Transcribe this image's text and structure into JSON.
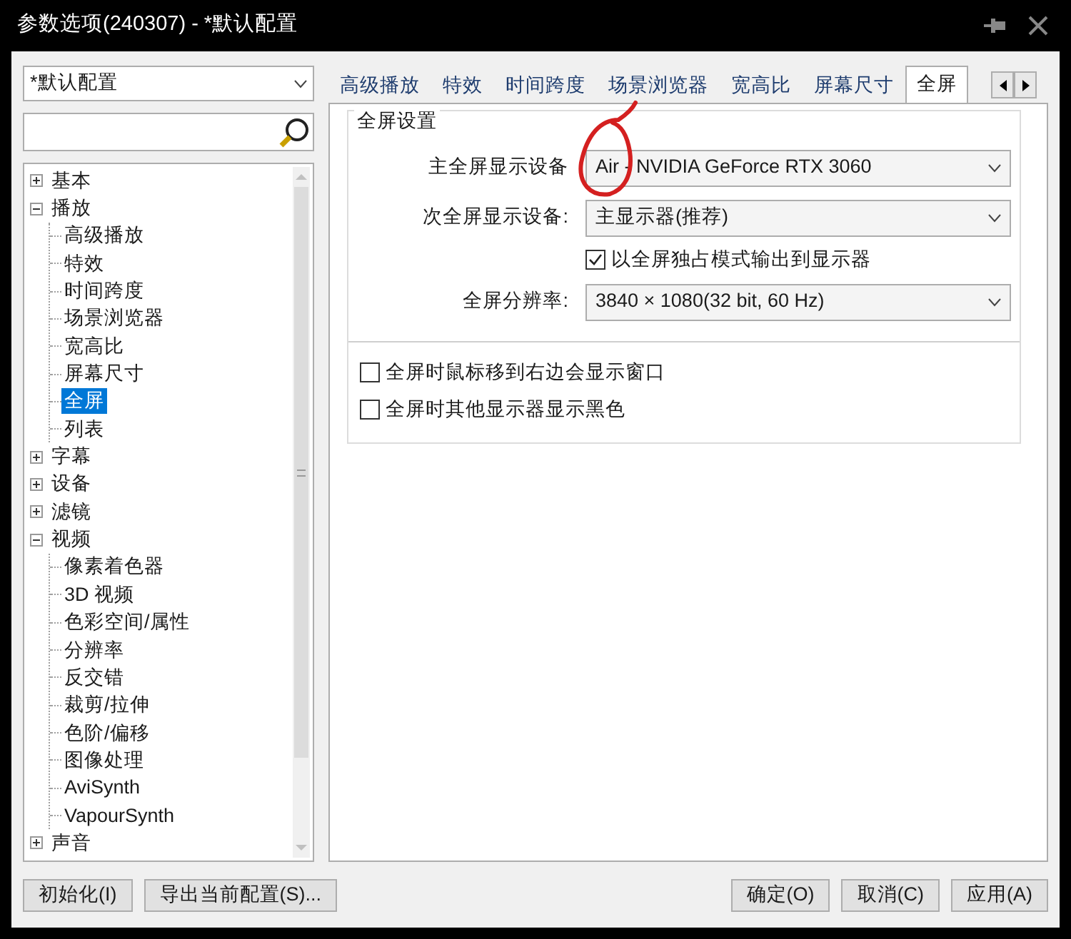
{
  "window": {
    "title": "参数选项(240307) - *默认配置"
  },
  "profile": {
    "value": "*默认配置"
  },
  "tree": [
    {
      "label": "基本",
      "expanded": false,
      "selected": false
    },
    {
      "label": "播放",
      "expanded": true,
      "selected": false,
      "children": [
        {
          "label": "高级播放",
          "selected": false
        },
        {
          "label": "特效",
          "selected": false
        },
        {
          "label": "时间跨度",
          "selected": false
        },
        {
          "label": "场景浏览器",
          "selected": false
        },
        {
          "label": "宽高比",
          "selected": false
        },
        {
          "label": "屏幕尺寸",
          "selected": false
        },
        {
          "label": "全屏",
          "selected": true
        },
        {
          "label": "列表",
          "selected": false
        }
      ]
    },
    {
      "label": "字幕",
      "expanded": false,
      "selected": false
    },
    {
      "label": "设备",
      "expanded": false,
      "selected": false
    },
    {
      "label": "滤镜",
      "expanded": false,
      "selected": false
    },
    {
      "label": "视频",
      "expanded": true,
      "selected": false,
      "children": [
        {
          "label": "像素着色器",
          "selected": false
        },
        {
          "label": "3D 视频",
          "selected": false
        },
        {
          "label": "色彩空间/属性",
          "selected": false
        },
        {
          "label": "分辨率",
          "selected": false
        },
        {
          "label": "反交错",
          "selected": false
        },
        {
          "label": "裁剪/拉伸",
          "selected": false
        },
        {
          "label": "色阶/偏移",
          "selected": false
        },
        {
          "label": "图像处理",
          "selected": false
        },
        {
          "label": "AviSynth",
          "selected": false
        },
        {
          "label": "VapourSynth",
          "selected": false
        }
      ]
    },
    {
      "label": "声音",
      "expanded": false,
      "selected": false
    }
  ],
  "tabs": [
    {
      "label": "高级播放",
      "selected": false
    },
    {
      "label": "特效",
      "selected": false
    },
    {
      "label": "时间跨度",
      "selected": false
    },
    {
      "label": "场景浏览器",
      "selected": false
    },
    {
      "label": "宽高比",
      "selected": false
    },
    {
      "label": "屏幕尺寸",
      "selected": false
    },
    {
      "label": "全屏",
      "selected": true
    }
  ],
  "group": {
    "title": "全屏设置",
    "fields": [
      {
        "kind": "select",
        "label": "主全屏显示设备",
        "value": "Air - NVIDIA GeForce RTX 3060"
      },
      {
        "kind": "select",
        "label": "次全屏显示设备:",
        "value": "主显示器(推荐)"
      },
      {
        "kind": "checkbox",
        "label": "以全屏独占模式输出到显示器",
        "checked": true
      },
      {
        "kind": "select",
        "label": "全屏分辨率:",
        "value": "3840 × 1080(32 bit, 60 Hz)"
      }
    ]
  },
  "options": [
    {
      "label": "全屏时鼠标移到右边会显示窗口",
      "checked": false
    },
    {
      "label": "全屏时其他显示器显示黑色",
      "checked": false
    }
  ],
  "buttons_left": [
    "初始化(I)",
    "导出当前配置(S)..."
  ],
  "buttons_right": [
    "确定(O)",
    "取消(C)",
    "应用(A)"
  ]
}
